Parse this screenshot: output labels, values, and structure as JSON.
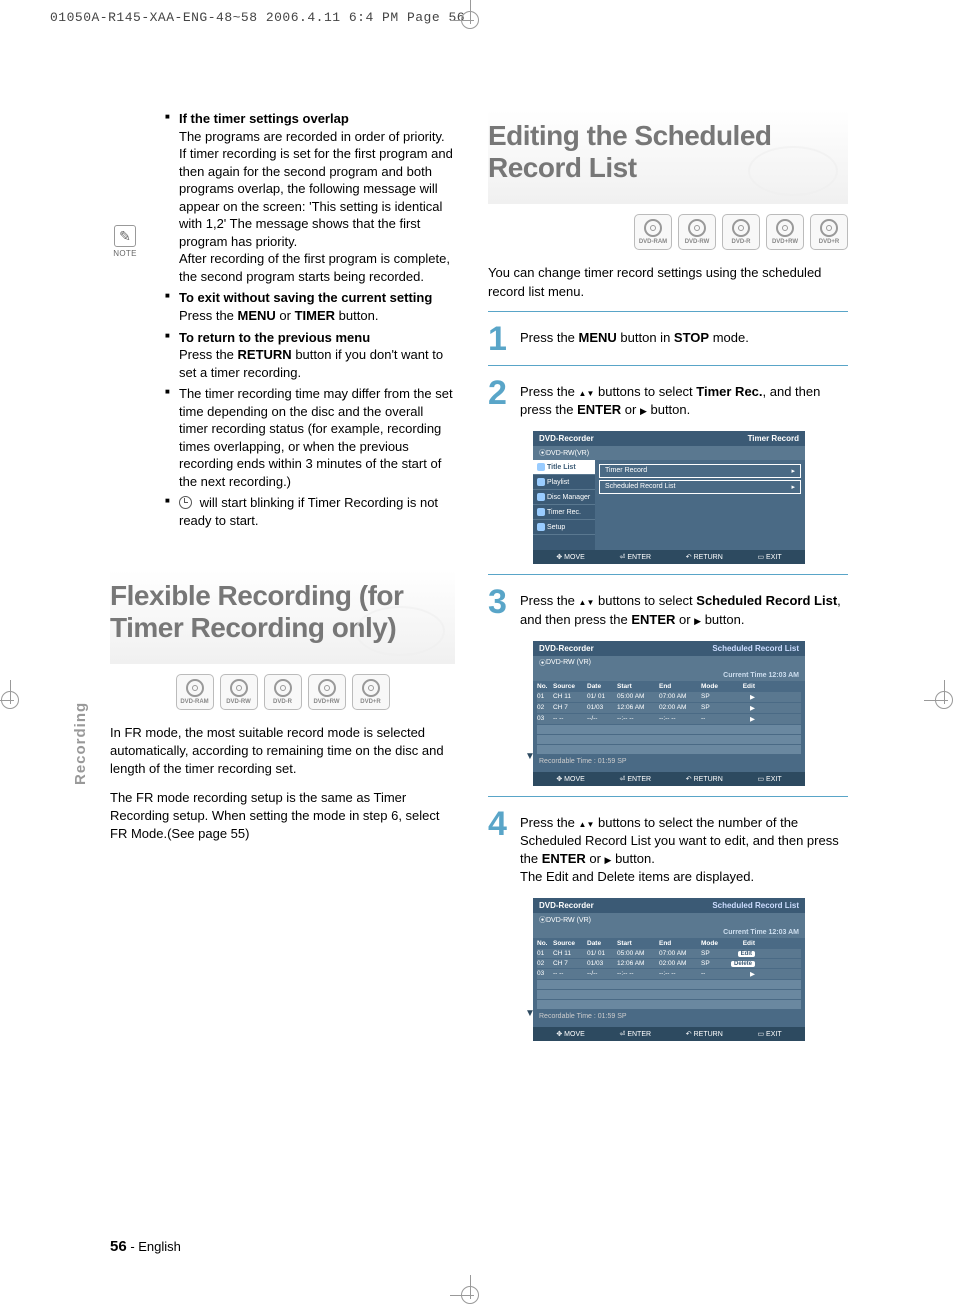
{
  "header": "01050A-R145-XAA-ENG-48~58  2006.4.11  6:4 PM  Page 56",
  "note_label": "NOTE",
  "notes": {
    "overlap_head": "If the timer settings overlap",
    "overlap_body1": "The programs are recorded in order of priority. If timer recording is set for the first program and then again for the second program and both programs overlap, the following message will appear on the screen: 'This setting is identical with 1,2' The message shows that the first program has priority.",
    "overlap_body2": "After recording of the first program is complete, the second program starts being recorded.",
    "exit_head": "To exit without saving the current setting",
    "exit_body": "Press the ",
    "exit_b1": "MENU",
    "exit_mid": " or ",
    "exit_b2": "TIMER",
    "exit_end": " button.",
    "return_head": "To return to the previous menu",
    "return_body1": "Press the ",
    "return_b1": "RETURN",
    "return_body2": " button if you don't want to set a timer recording.",
    "differ": "The timer recording time may differ from the set time depending on the disc and the overall timer recording status (for example, recording times overlapping, or when the previous recording ends within 3 minutes of the start of the next recording.)",
    "blink": " will start blinking if Timer Recording is not ready to start."
  },
  "flexible": {
    "title": "Flexible Recording (for Timer Recording only)",
    "discs": [
      "DVD-RAM",
      "DVD-RW",
      "DVD-R",
      "DVD+RW",
      "DVD+R"
    ],
    "p1": "In FR mode, the most suitable record mode is selected automatically, according to remaining time on the disc and length of the timer recording set.",
    "p2": "The FR mode recording setup is the same as Timer Recording setup. When setting the mode in step 6, select FR Mode.(See page 55)"
  },
  "side_tab": "Recording",
  "editing": {
    "title": "Editing the Scheduled Record List",
    "discs": [
      "DVD-RAM",
      "DVD-RW",
      "DVD-R",
      "DVD+RW",
      "DVD+R"
    ],
    "intro": "You can change timer record settings using the scheduled record list menu.",
    "steps": {
      "s1a": "Press the ",
      "s1b": "MENU",
      "s1c": " button in ",
      "s1d": "STOP",
      "s1e": " mode.",
      "s2a": "Press the ",
      "s2b": " buttons to select ",
      "s2c": "Timer Rec.",
      "s2d": ", and then press the ",
      "s2e": "ENTER",
      "s2f": " or ",
      "s2g": " button.",
      "s3a": "Press the ",
      "s3b": " buttons to select ",
      "s3c": "Scheduled Record List",
      "s3d": ", and then press the ",
      "s3e": "ENTER",
      "s3f": " or ",
      "s3g": " button.",
      "s4a": "Press the ",
      "s4b": " buttons to select the number of the Scheduled Record List you want to edit, and then press the ",
      "s4c": "ENTER",
      "s4d": " or ",
      "s4e": " button.",
      "s4f": "The Edit and Delete items are displayed."
    }
  },
  "osd1": {
    "title_l": "DVD-Recorder",
    "title_r": "Timer Record",
    "sub": "DVD-RW(VR)",
    "menu": [
      "Title List",
      "Playlist",
      "Disc Manager",
      "Timer Rec.",
      "Setup"
    ],
    "main1": "Timer Record",
    "main2": "Scheduled Record List",
    "foot": [
      "MOVE",
      "ENTER",
      "RETURN",
      "EXIT"
    ]
  },
  "osd2": {
    "title_l": "DVD-Recorder",
    "title_r": "Scheduled Record List",
    "sub": "DVD-RW (VR)",
    "ct": "Current Time  12:03 AM",
    "cols": [
      "No.",
      "Source",
      "Date",
      "Start",
      "End",
      "Mode",
      "Edit"
    ],
    "rows": [
      {
        "no": "01",
        "src": "CH 11",
        "dt": "01/ 01",
        "st": "05:00 AM",
        "ed": "07:00 AM",
        "md": "SP",
        "ei": "▶"
      },
      {
        "no": "02",
        "src": "CH 7",
        "dt": "01/03",
        "st": "12:06 AM",
        "ed": "02:00 AM",
        "md": "SP",
        "ei": "▶"
      },
      {
        "no": "03",
        "src": "-- --",
        "dt": "--/--",
        "st": "--:-- --",
        "ed": "--:-- --",
        "md": "--",
        "ei": "▶"
      }
    ],
    "rec": "Recordable Time :  01:59  SP",
    "foot": [
      "MOVE",
      "ENTER",
      "RETURN",
      "EXIT"
    ]
  },
  "osd3": {
    "title_l": "DVD-Recorder",
    "title_r": "Scheduled Record List",
    "sub": "DVD-RW (VR)",
    "ct": "Current Time  12:03 AM",
    "cols": [
      "No.",
      "Source",
      "Date",
      "Start",
      "End",
      "Mode",
      "Edit"
    ],
    "rows": [
      {
        "no": "01",
        "src": "CH 11",
        "dt": "01/ 01",
        "st": "05:00 AM",
        "ed": "07:00 AM",
        "md": "SP",
        "ei": "Edit"
      },
      {
        "no": "02",
        "src": "CH 7",
        "dt": "01/03",
        "st": "12:06 AM",
        "ed": "02:00 AM",
        "md": "SP",
        "ei": "Delete"
      },
      {
        "no": "03",
        "src": "-- --",
        "dt": "--/--",
        "st": "--:-- --",
        "ed": "--:-- --",
        "md": "--",
        "ei": "▶"
      }
    ],
    "rec": "Recordable Time :  01:59  SP",
    "foot": [
      "MOVE",
      "ENTER",
      "RETURN",
      "EXIT"
    ]
  },
  "footer": {
    "page": "56",
    "lang": "- English"
  }
}
